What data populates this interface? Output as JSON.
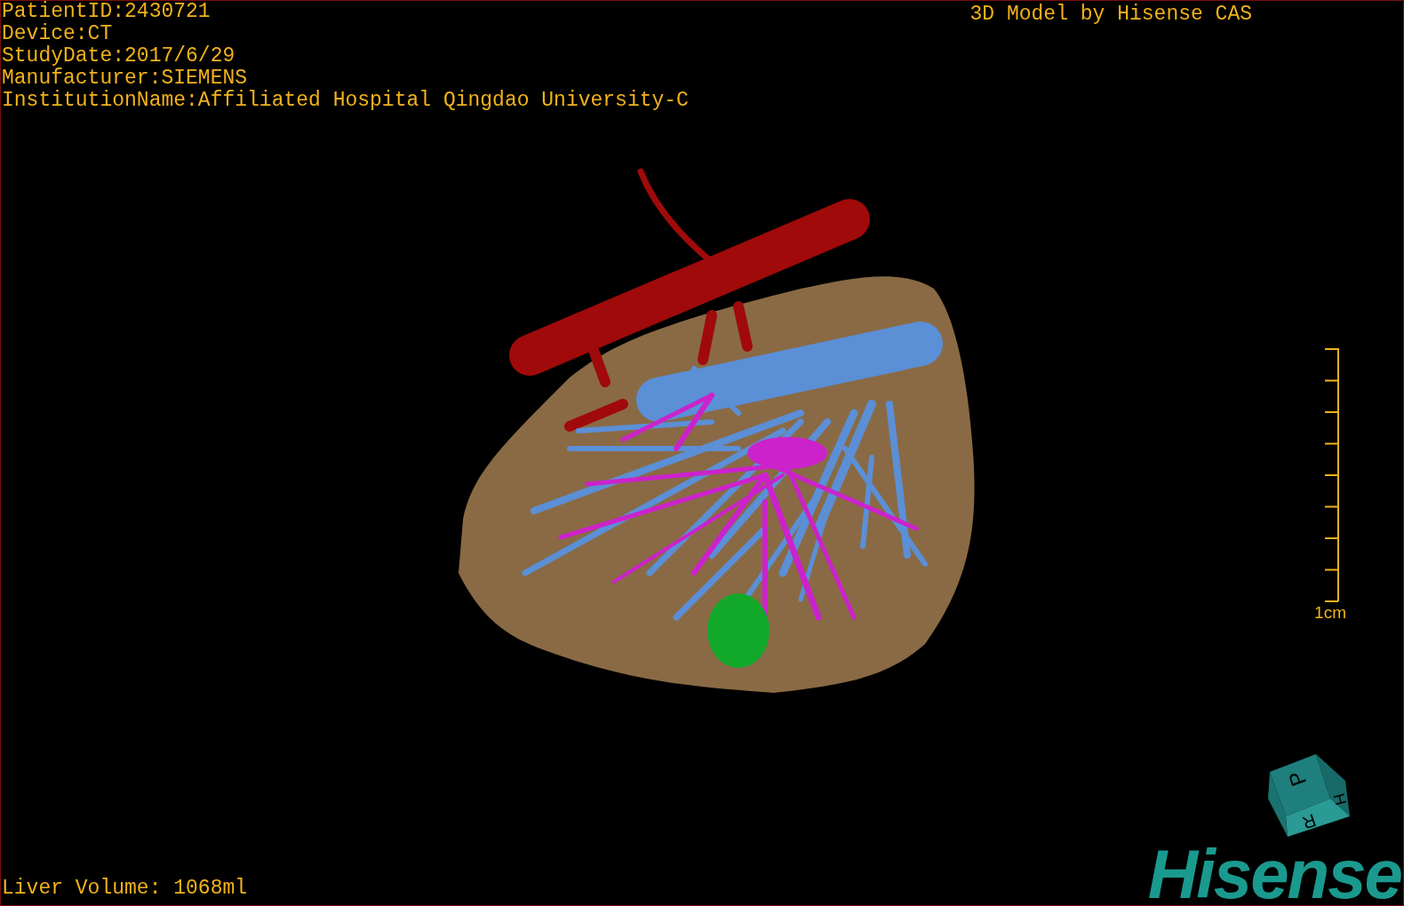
{
  "patient_info": [
    "PatientID:2430721",
    "Device:CT",
    "StudyDate:2017/6/29",
    "Manufacturer:SIEMENS",
    "InstitutionName:Affiliated Hospital Qingdao University-C"
  ],
  "title": "3D Model by Hisense CAS",
  "scale_bar": {
    "label": "1cm"
  },
  "orientation_cube": {
    "labels": [
      "P",
      "H",
      "R"
    ]
  },
  "logo": {
    "text": "Hisense"
  },
  "liver_volume": "Liver Volume: 1068ml"
}
